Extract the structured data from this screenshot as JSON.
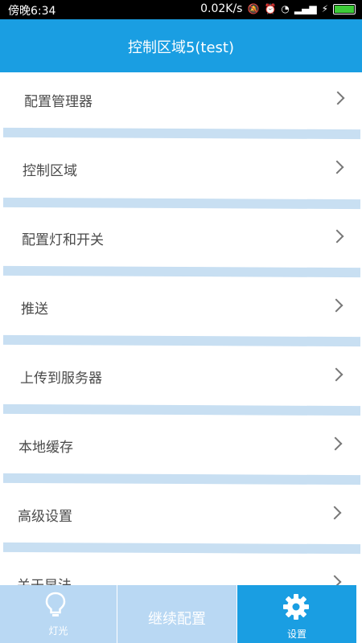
{
  "status_bar": {
    "time": "傍晚6:34",
    "network_speed": "0.02K/s",
    "icons": [
      "mute-icon",
      "alarm-icon",
      "wifi-icon",
      "signal-icon",
      "charging-icon",
      "battery-icon"
    ]
  },
  "header": {
    "title": "控制区域5(test)"
  },
  "menu": {
    "items": [
      {
        "label": "配置管理器"
      },
      {
        "label": "控制区域"
      },
      {
        "label": "配置灯和开关"
      },
      {
        "label": "推送"
      },
      {
        "label": "上传到服务器"
      },
      {
        "label": "本地缓存"
      },
      {
        "label": "高级设置"
      },
      {
        "label": "关于早法"
      }
    ]
  },
  "tabbar": {
    "light_label": "灯光",
    "continue_label": "继续配置",
    "settings_label": "设置",
    "colors": {
      "active": "#1a9ee2",
      "inactive": "#b9d8f3"
    }
  }
}
